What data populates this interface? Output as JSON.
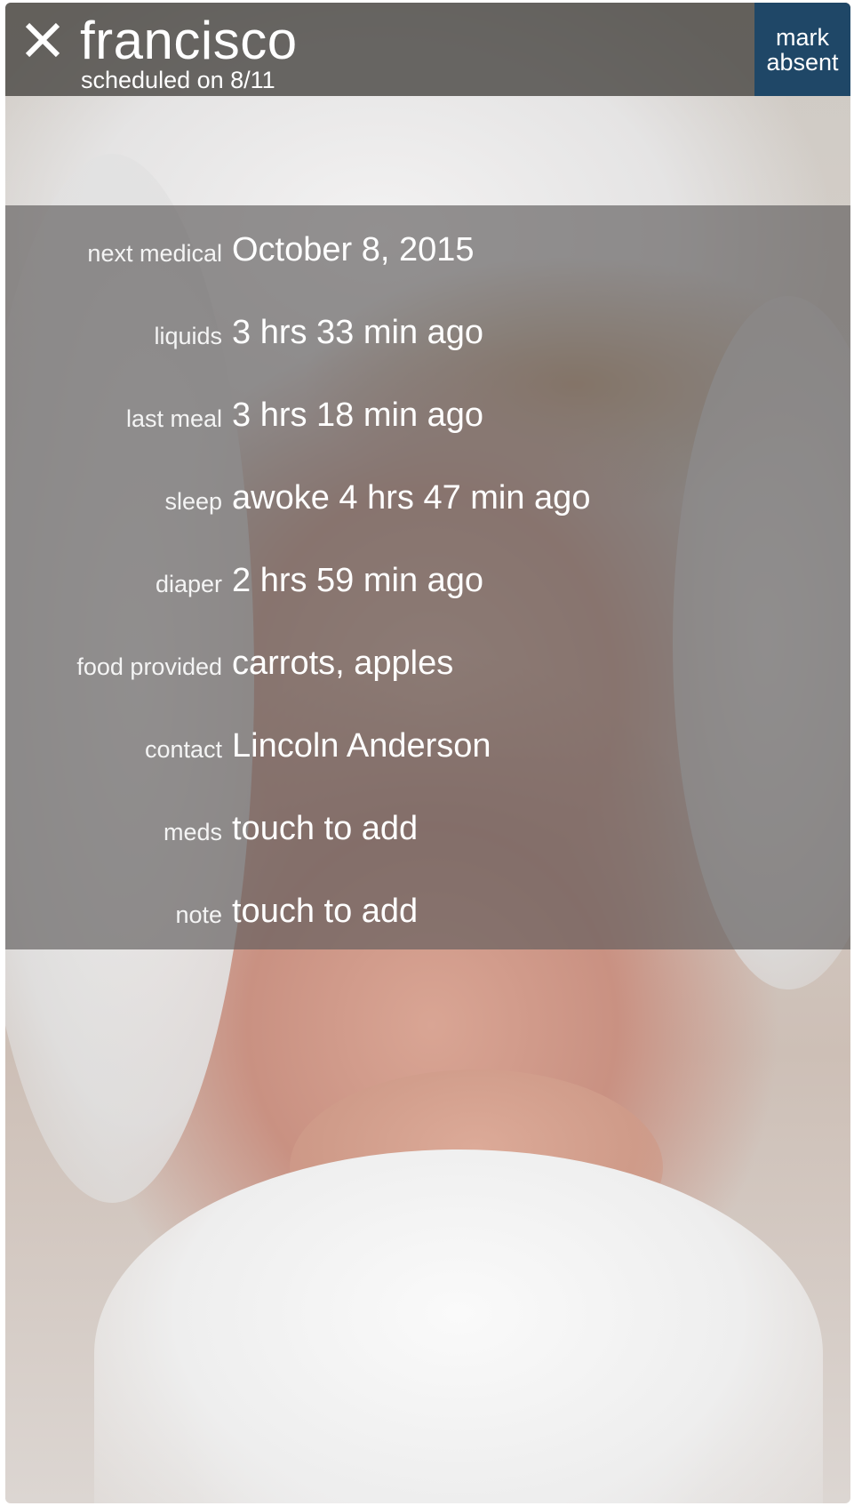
{
  "header": {
    "close_icon": "close-icon",
    "child_name": "francisco",
    "scheduled": "scheduled on 8/11",
    "mark_absent_line1": "mark",
    "mark_absent_line2": "absent",
    "mark_absent_color": "#1f4767"
  },
  "details": [
    {
      "label": "next medical",
      "value": "October 8, 2015"
    },
    {
      "label": "liquids",
      "value": "3 hrs 33 min ago"
    },
    {
      "label": "last meal",
      "value": "3 hrs 18 min ago"
    },
    {
      "label": "sleep",
      "value": "awoke 4 hrs 47 min ago"
    },
    {
      "label": "diaper",
      "value": "2 hrs 59 min ago"
    },
    {
      "label": "food provided",
      "value": "carrots, apples"
    },
    {
      "label": "contact",
      "value": "Lincoln Anderson"
    },
    {
      "label": "meds",
      "value": "touch to add"
    },
    {
      "label": "note",
      "value": "touch to add"
    }
  ]
}
